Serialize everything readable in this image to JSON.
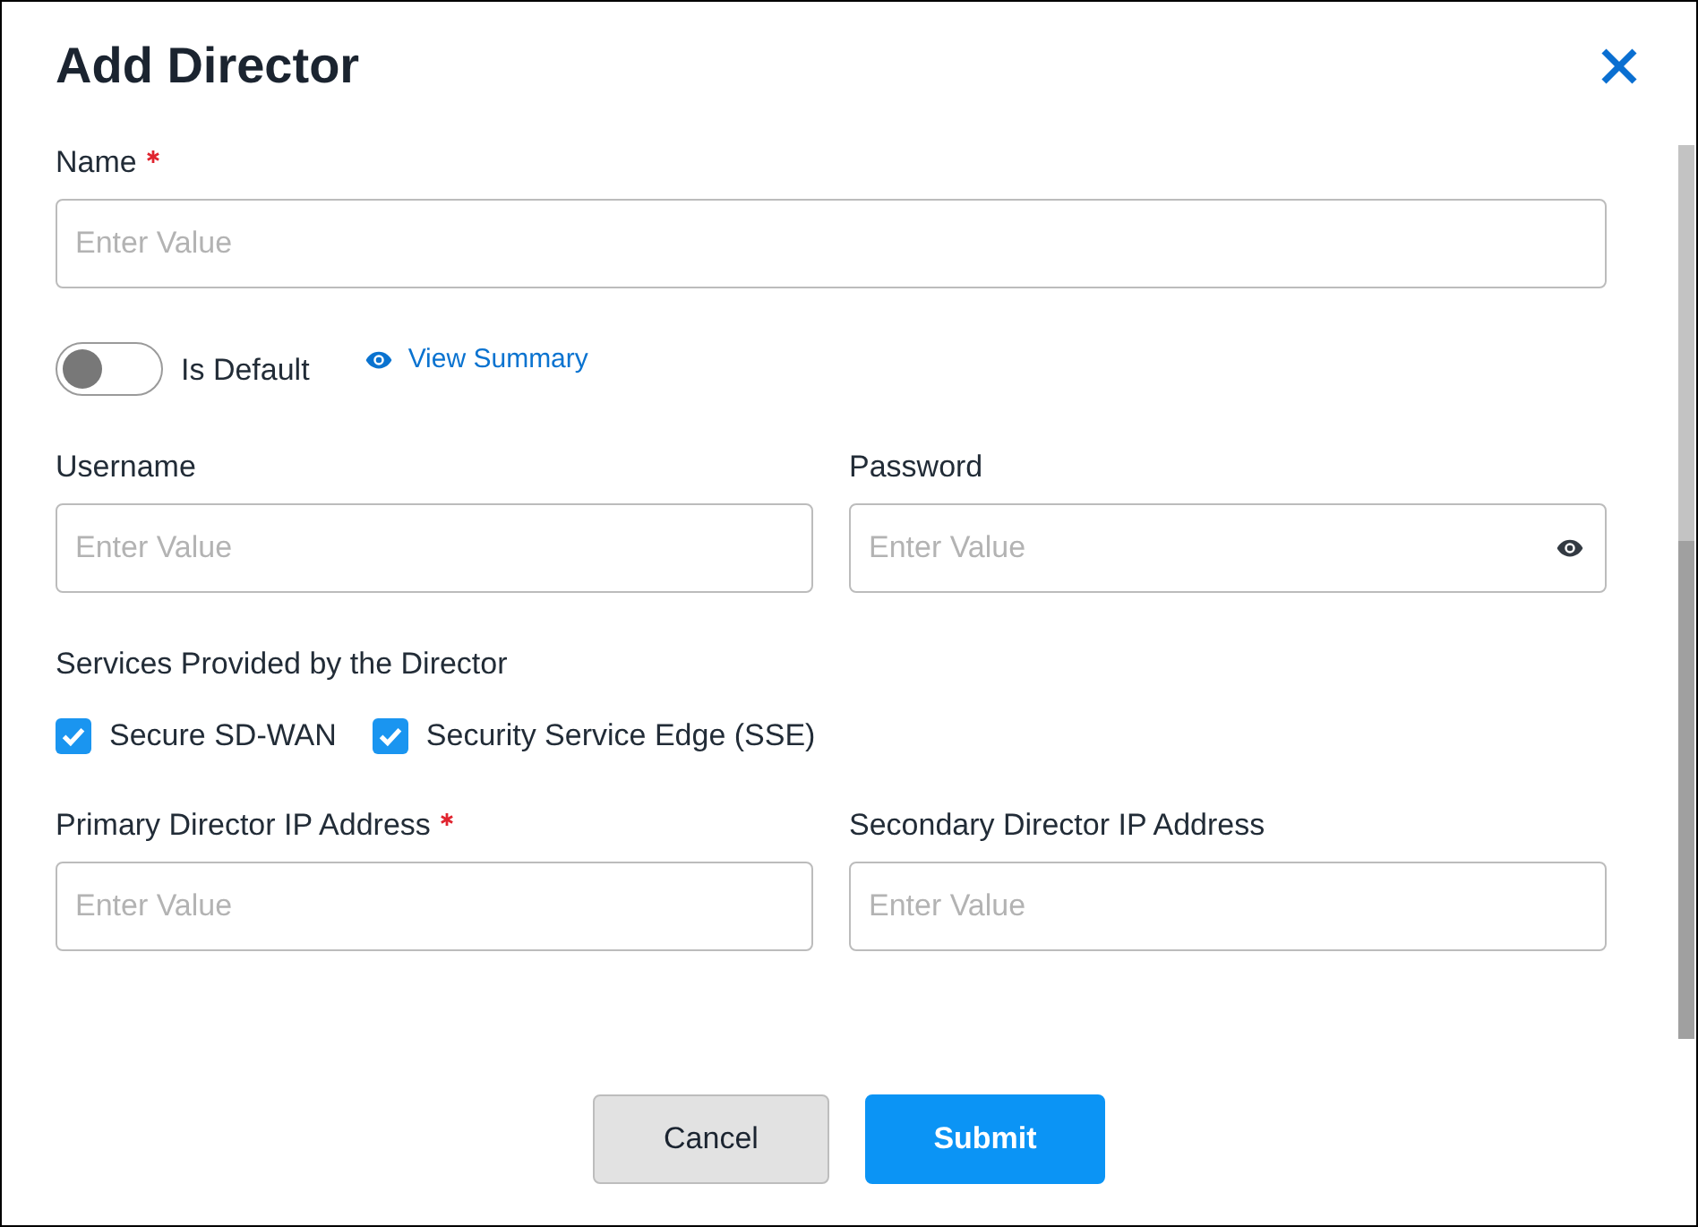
{
  "dialog": {
    "title": "Add Director"
  },
  "name_field": {
    "label": "Name",
    "required": true,
    "placeholder": "Enter Value"
  },
  "default_toggle": {
    "label": "Is Default",
    "on": false
  },
  "view_summary_link": {
    "label": "View Summary"
  },
  "credential_fields": [
    {
      "label": "Username",
      "kind": "text",
      "placeholder": "Enter Value"
    },
    {
      "label": "Password",
      "kind": "password",
      "placeholder": "Enter Value"
    }
  ],
  "services": {
    "label": "Services Provided by the Director",
    "options": [
      {
        "label": "Secure SD-WAN",
        "checked": true
      },
      {
        "label": "Security Service Edge (SSE)",
        "checked": true
      }
    ]
  },
  "director_ip_fields": [
    {
      "label": "Primary Director IP Address",
      "required": true,
      "placeholder": "Enter Value"
    },
    {
      "label": "Secondary Director IP Address",
      "required": false,
      "placeholder": "Enter Value"
    }
  ],
  "buttons": [
    {
      "label": "Cancel",
      "kind": "secondary"
    },
    {
      "label": "Submit",
      "kind": "primary"
    }
  ]
}
